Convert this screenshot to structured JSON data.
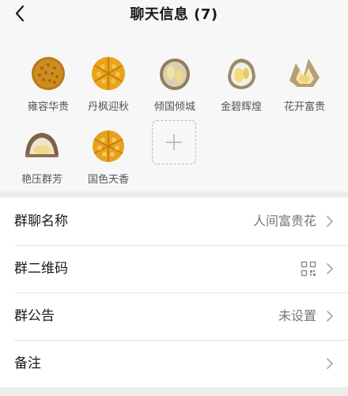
{
  "header": {
    "title": "聊天信息 (7)"
  },
  "members": [
    {
      "name": "雍容华贵",
      "avatar": "durian-round-icon"
    },
    {
      "name": "丹枫迎秋",
      "avatar": "durian-round-icon"
    },
    {
      "name": "倾国倾城",
      "avatar": "durian-split-icon"
    },
    {
      "name": "金碧辉煌",
      "avatar": "durian-split-icon"
    },
    {
      "name": "花开富贵",
      "avatar": "durian-open-icon"
    },
    {
      "name": "艳压群芳",
      "avatar": "durian-half-icon"
    },
    {
      "name": "国色天香",
      "avatar": "durian-round-icon"
    }
  ],
  "add_member": {
    "icon": "plus-icon"
  },
  "settings": [
    {
      "label": "群聊名称",
      "value": "人间富贵花"
    },
    {
      "label": "群二维码",
      "icon": "qr-code-icon"
    },
    {
      "label": "群公告",
      "value": "未设置"
    },
    {
      "label": "备注",
      "value": ""
    }
  ],
  "colors": {
    "background": "#ededed",
    "panel": "#f7f7f7",
    "durian_yellow": "#e6a21a",
    "durian_shell": "#b7a58a"
  }
}
